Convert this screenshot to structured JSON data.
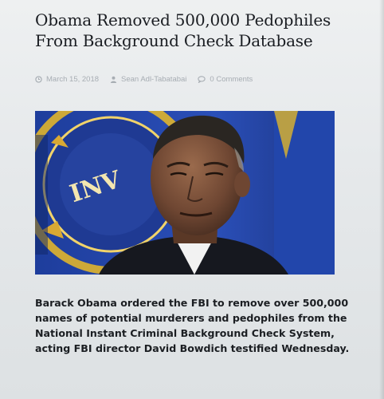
{
  "article": {
    "headline": "Obama Removed 500,000 Pedophiles From Background Check Database",
    "meta": {
      "date": "March 15, 2018",
      "author": "Sean Adl-Tabatabai",
      "comments": "0 Comments",
      "date_icon": "clock-icon",
      "author_icon": "person-icon",
      "comments_icon": "speech-bubble-icon"
    },
    "image": {
      "subject": "man in dark suit in front of FBI seal flag",
      "flag_text": "INV"
    },
    "body": "Barack Obama ordered the FBI to remove over 500,000 names of potential murderers and pedophiles from the National Instant Criminal Background Check System, acting FBI director David Bowdich testified Wednesday."
  },
  "colors": {
    "headline": "#1a1d22",
    "meta": "#a7adb3",
    "flag_blue": "#233f96",
    "flag_gold": "#e0b52c"
  }
}
